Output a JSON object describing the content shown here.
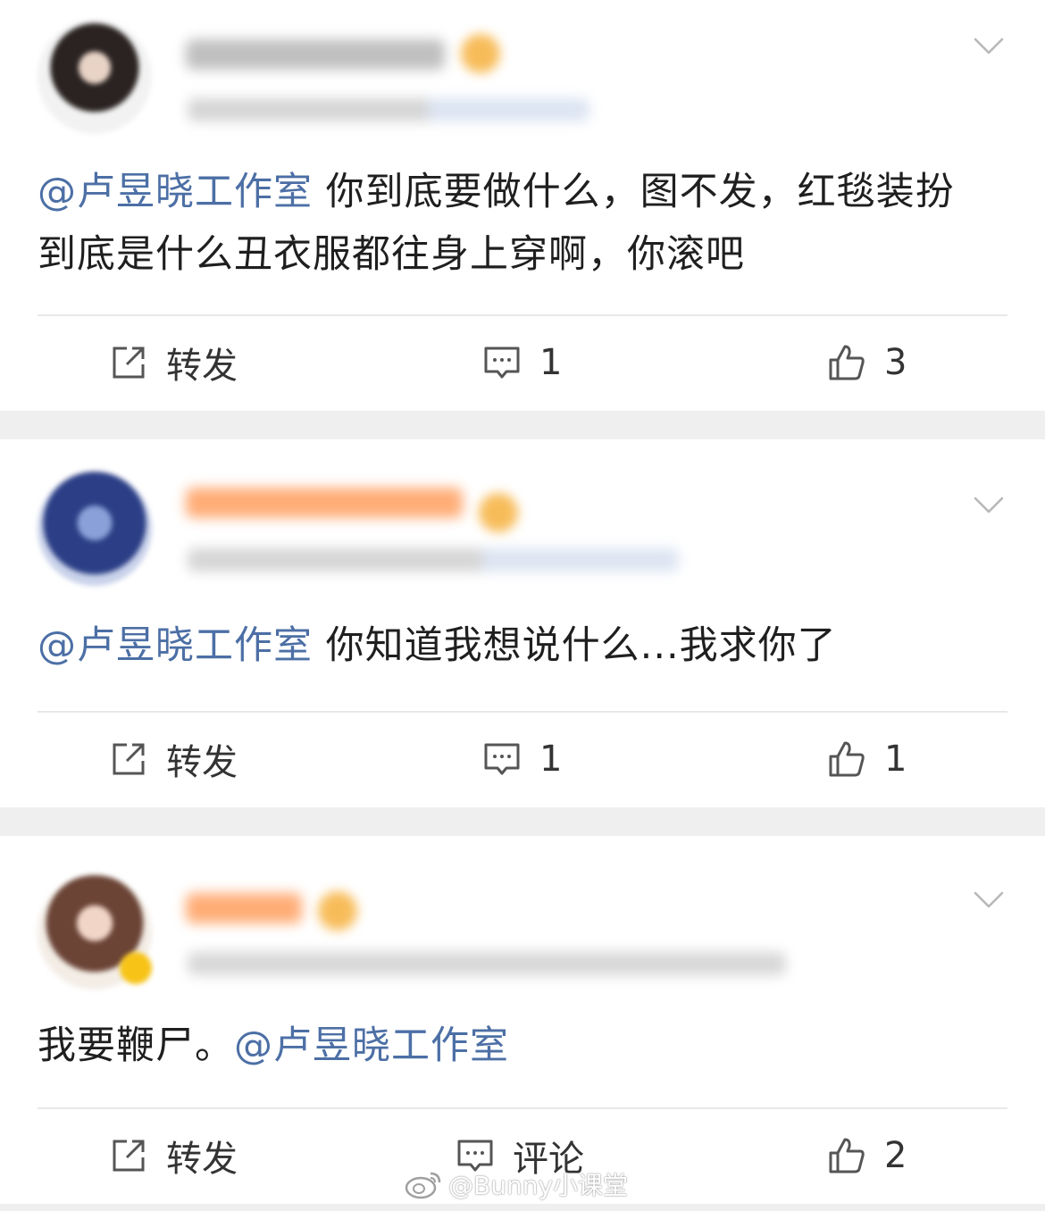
{
  "posts": [
    {
      "mention": "@卢昱晓工作室",
      "text": " 你到底要做什么，图不发，红毯装扮到底是什么丑衣服都往身上穿啊，你滚吧",
      "repost_label": "转发",
      "comment_label": "1",
      "like_label": "3"
    },
    {
      "mention": "@卢昱晓工作室",
      "text": " 你知道我想说什么...我求你了",
      "repost_label": "转发",
      "comment_label": "1",
      "like_label": "1"
    },
    {
      "text": "我要鞭尸。",
      "mention": "@卢昱晓工作室",
      "repost_label": "转发",
      "comment_label": "评论",
      "like_label": "2"
    }
  ],
  "watermark": "@Bunny小课堂",
  "colors": {
    "mention": "#4c6fa5",
    "text": "#1f1f1f",
    "icon": "#555555",
    "background": "#efefef"
  },
  "icons": [
    "chevron-down-icon",
    "repost-icon",
    "comment-icon",
    "like-icon",
    "weibo-logo-icon"
  ]
}
